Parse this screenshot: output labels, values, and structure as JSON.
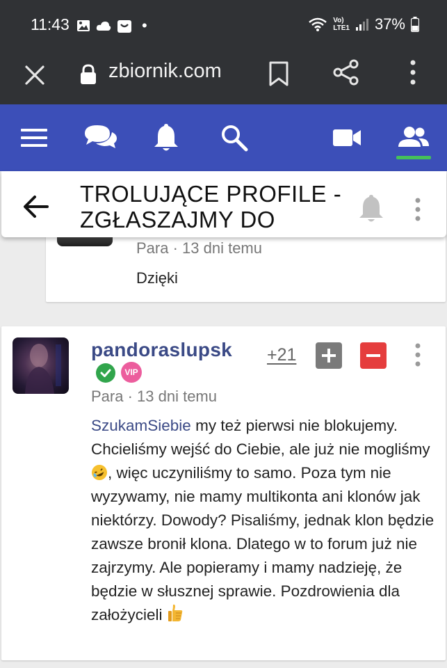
{
  "status_bar": {
    "time": "11:43",
    "dot": "•",
    "signal_label_top": "Vo)",
    "signal_label_bottom": "LTE1",
    "battery": "37%",
    "icons": [
      "image-icon",
      "cloud-icon",
      "shopping-bag-icon",
      "wifi-icon",
      "signal-icon",
      "battery-icon"
    ]
  },
  "browser": {
    "url": "zbiornik.com",
    "icons": [
      "close-icon",
      "lock-icon",
      "bookmark-icon",
      "share-icon",
      "more-vert-icon"
    ]
  },
  "nav": {
    "icons": [
      "menu-icon",
      "chat-icon",
      "bell-icon",
      "search-icon",
      "video-icon",
      "users-icon"
    ],
    "active": "users-icon",
    "accent": "#45c05a",
    "background": "#3c4fb8"
  },
  "topic": {
    "title": "TROLUJĄCE PROFILE - ZGŁASZAJMY DO",
    "icons": [
      "back-arrow-icon",
      "bell-icon",
      "more-vert-icon"
    ]
  },
  "posts": [
    {
      "meta": "Para · 13 dni temu",
      "text": "Dzięki"
    },
    {
      "username": "pandoraslupsk",
      "badges": [
        "verified-check-icon",
        "vip-badge"
      ],
      "vip_label": "VIP",
      "score": "+21",
      "meta": "Para · 13 dni temu",
      "mention": "SzukamSiebie",
      "text_1": " my też pierwsi nie blokujemy. Chcieliśmy wejść do Ciebie, ale już nie mogliśmy ",
      "text_2": ", więc uczyniliśmy to samo. Poza tym nie wyzywamy, nie mamy multikonta ani klonów jak niektórzy. Dowody? Pisaliśmy, jednak klon będzie zawsze bronił klona. Dlatego w to forum już nie zajrzymy. Ale popieramy i mamy nadzieję, że będzie w słusznej sprawie. Pozdrowienia dla założycieli ",
      "emojis": [
        "rolling-laughing-emoji",
        "thumbs-up-emoji"
      ]
    }
  ]
}
